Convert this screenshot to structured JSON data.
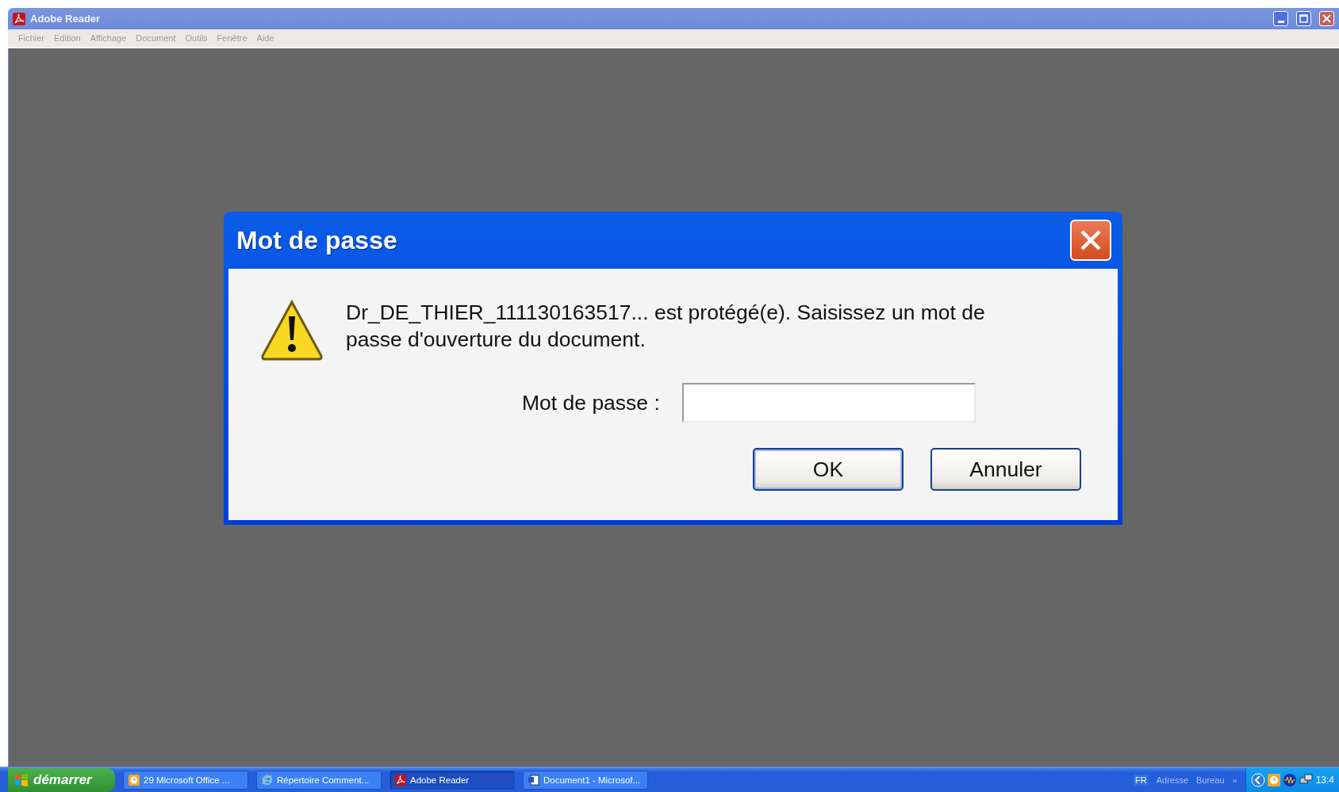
{
  "window": {
    "title": "Adobe Reader"
  },
  "menu": [
    "Fichier",
    "Edition",
    "Affichage",
    "Document",
    "Outils",
    "Fenêtre",
    "Aide"
  ],
  "dialog": {
    "title": "Mot de passe",
    "message": "Dr_DE_THIER_111130163517... est protégé(e). Saisissez un mot de passe d'ouverture du document.",
    "field_label": "Mot de passe :",
    "buttons": [
      "OK",
      "Annuler"
    ]
  },
  "taskbar": {
    "start": "démarrer",
    "tasks": [
      {
        "label": "29 Microsoft Office ...",
        "kind": "office",
        "selected": false
      },
      {
        "label": "Répertoire Comment...",
        "kind": "browser",
        "selected": false
      },
      {
        "label": "Adobe Reader",
        "kind": "pdf",
        "selected": true
      },
      {
        "label": "Document1 - Microsof...",
        "kind": "word",
        "selected": false
      }
    ],
    "language": "FR",
    "toolbars": [
      "Adresse",
      "Bureau"
    ],
    "chevron": "»",
    "clock": "13:4"
  }
}
